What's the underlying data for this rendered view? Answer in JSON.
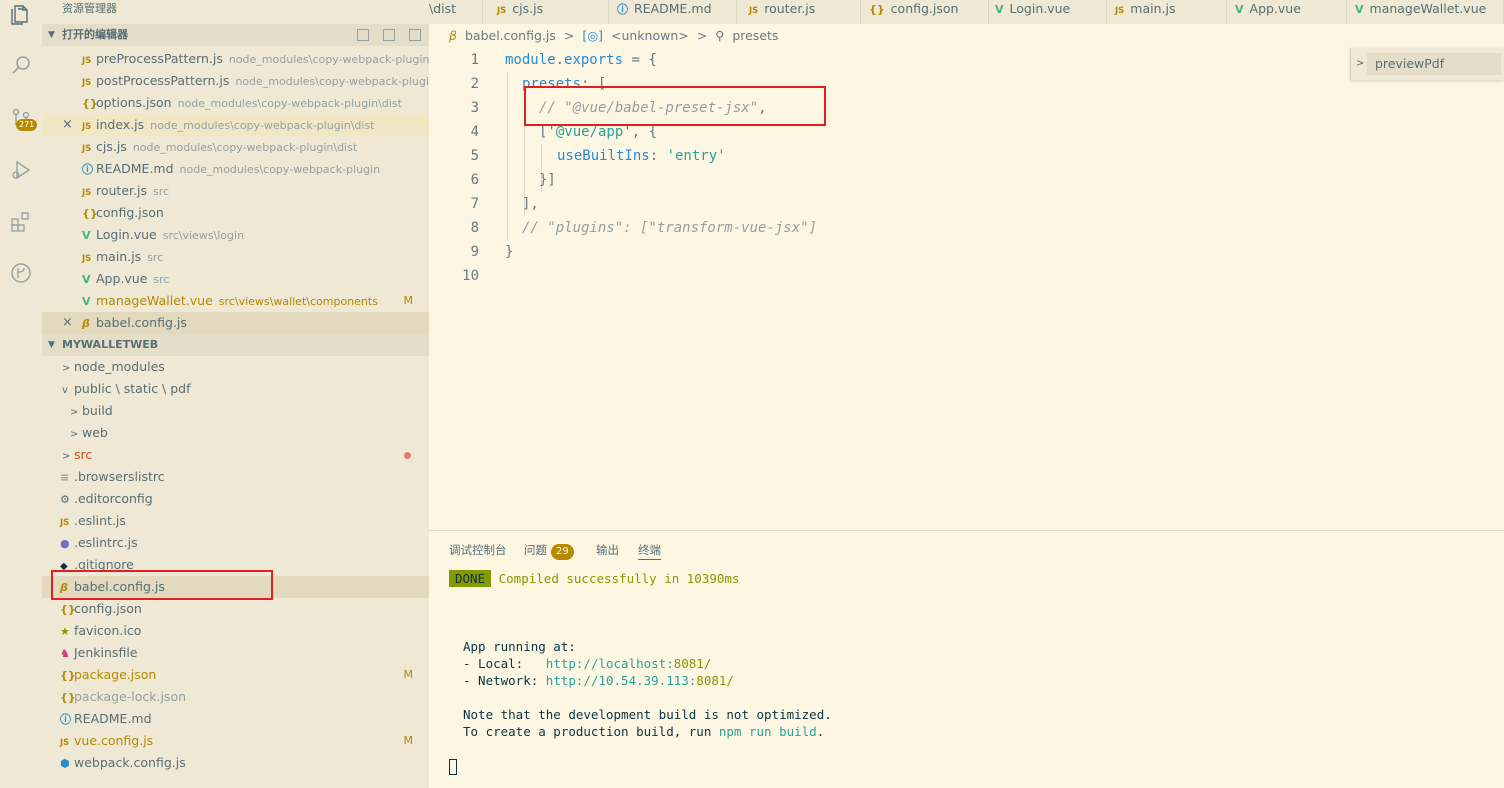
{
  "activity_bar": {
    "items": [
      "explorer-icon",
      "search-icon",
      "source-control-icon",
      "run-debug-icon",
      "extensions-icon",
      "git-graph-icon"
    ],
    "scm_badge": "271"
  },
  "sidebar": {
    "title": "资源管理器",
    "open_editors_title": "打开的编辑器",
    "open_editors": [
      {
        "name": "preProcessPattern.js",
        "desc": "node_modules\\copy-webpack-plugin\\...",
        "icon": "JS"
      },
      {
        "name": "postProcessPattern.js",
        "desc": "node_modules\\copy-webpack-plugin...",
        "icon": "JS"
      },
      {
        "name": "options.json",
        "desc": "node_modules\\copy-webpack-plugin\\dist",
        "icon": "{}"
      },
      {
        "name": "index.js",
        "desc": "node_modules\\copy-webpack-plugin\\dist",
        "icon": "JS",
        "close": "×"
      },
      {
        "name": "cjs.js",
        "desc": "node_modules\\copy-webpack-plugin\\dist",
        "icon": "JS"
      },
      {
        "name": "README.md",
        "desc": "node_modules\\copy-webpack-plugin",
        "icon": "ⓘ"
      },
      {
        "name": "router.js",
        "desc": "src",
        "icon": "JS"
      },
      {
        "name": "config.json",
        "desc": "",
        "icon": "{}"
      },
      {
        "name": "Login.vue",
        "desc": "src\\views\\login",
        "icon": "V"
      },
      {
        "name": "main.js",
        "desc": "src",
        "icon": "JS"
      },
      {
        "name": "App.vue",
        "desc": "src",
        "icon": "V"
      },
      {
        "name": "manageWallet.vue",
        "desc": "src\\views\\wallet\\components",
        "icon": "V",
        "mark": "M"
      },
      {
        "name": "babel.config.js",
        "desc": "",
        "icon": "β",
        "close": "×"
      }
    ],
    "project_title": "MYWALLETWEB",
    "tree": [
      {
        "name": "node_modules",
        "twisty": ">"
      },
      {
        "name": "public \\ static \\ pdf",
        "twisty": "v"
      },
      {
        "name": "build",
        "twisty": ">"
      },
      {
        "name": "web",
        "twisty": ">"
      },
      {
        "name": "src",
        "twisty": ">"
      },
      {
        "name": ".browserslistrc",
        "icon": "≡"
      },
      {
        "name": ".editorconfig",
        "icon": "⚙"
      },
      {
        "name": ".eslint.js",
        "icon": "JS"
      },
      {
        "name": ".eslintrc.js",
        "icon": "●"
      },
      {
        "name": ".gitignore",
        "icon": "◆"
      },
      {
        "name": "babel.config.js",
        "icon": "β"
      },
      {
        "name": "config.json",
        "icon": "{}"
      },
      {
        "name": "favicon.ico",
        "icon": "★"
      },
      {
        "name": "Jenkinsfile",
        "icon": "♞"
      },
      {
        "name": "package.json",
        "icon": "{}",
        "mark": "M"
      },
      {
        "name": "package-lock.json",
        "icon": "{}"
      },
      {
        "name": "README.md",
        "icon": "ⓘ"
      },
      {
        "name": "vue.config.js",
        "icon": "JS",
        "mark": "M"
      },
      {
        "name": "webpack.config.js",
        "icon": "⬢"
      }
    ]
  },
  "tabs": [
    {
      "label": "\\dist",
      "icon": ""
    },
    {
      "label": "cjs.js",
      "icon": "JS"
    },
    {
      "label": "README.md",
      "icon": "ⓘ"
    },
    {
      "label": "router.js",
      "icon": "JS"
    },
    {
      "label": "config.json",
      "icon": "{}"
    },
    {
      "label": "Login.vue",
      "icon": "V"
    },
    {
      "label": "main.js",
      "icon": "JS"
    },
    {
      "label": "App.vue",
      "icon": "V"
    },
    {
      "label": "manageWallet.vue",
      "icon": "V"
    }
  ],
  "breadcrumb": {
    "file": "babel.config.js",
    "sep1": ">",
    "symbol1": "<unknown>",
    "sep2": ">",
    "symbol2": "presets"
  },
  "editor": {
    "line_numbers": [
      "1",
      "2",
      "3",
      "4",
      "5",
      "6",
      "7",
      "8",
      "9",
      "10"
    ],
    "l1": {
      "a": "module",
      "b": ".",
      "c": "exports",
      "d": " = {"
    },
    "l2": {
      "a": "presets",
      "b": ": ["
    },
    "l3": {
      "a": "// \"@vue/babel-preset-jsx\"",
      "b": ","
    },
    "l4": {
      "a": "['",
      "b": "@vue/app",
      "c": "', {"
    },
    "l5": {
      "a": "useBuiltIns",
      "b": ": ",
      "c": "'entry'"
    },
    "l6": {
      "a": "}]"
    },
    "l7": {
      "a": "],"
    },
    "l8": {
      "a": "// \"plugins\": [\"transform-vue-jsx\"]"
    },
    "l9": {
      "a": "}"
    }
  },
  "peek": {
    "label": "previewPdf"
  },
  "panel": {
    "tabs": [
      "调试控制台",
      "问题",
      "输出",
      "终端"
    ],
    "problems_count": "29",
    "done_label": "DONE",
    "compiled": " Compiled successfully in 10390ms",
    "app_running": "App running at:",
    "local_label": "- Local:   ",
    "local_url": "http://localhost:",
    "local_port": "8081/",
    "network_label": "- Network: ",
    "network_url": "http://10.54.39.113:",
    "network_port": "8081/",
    "note1": "Note that the development build is not optimized.",
    "note2_a": "To create a production build, run ",
    "note2_b": "npm run build",
    "note2_c": "."
  }
}
